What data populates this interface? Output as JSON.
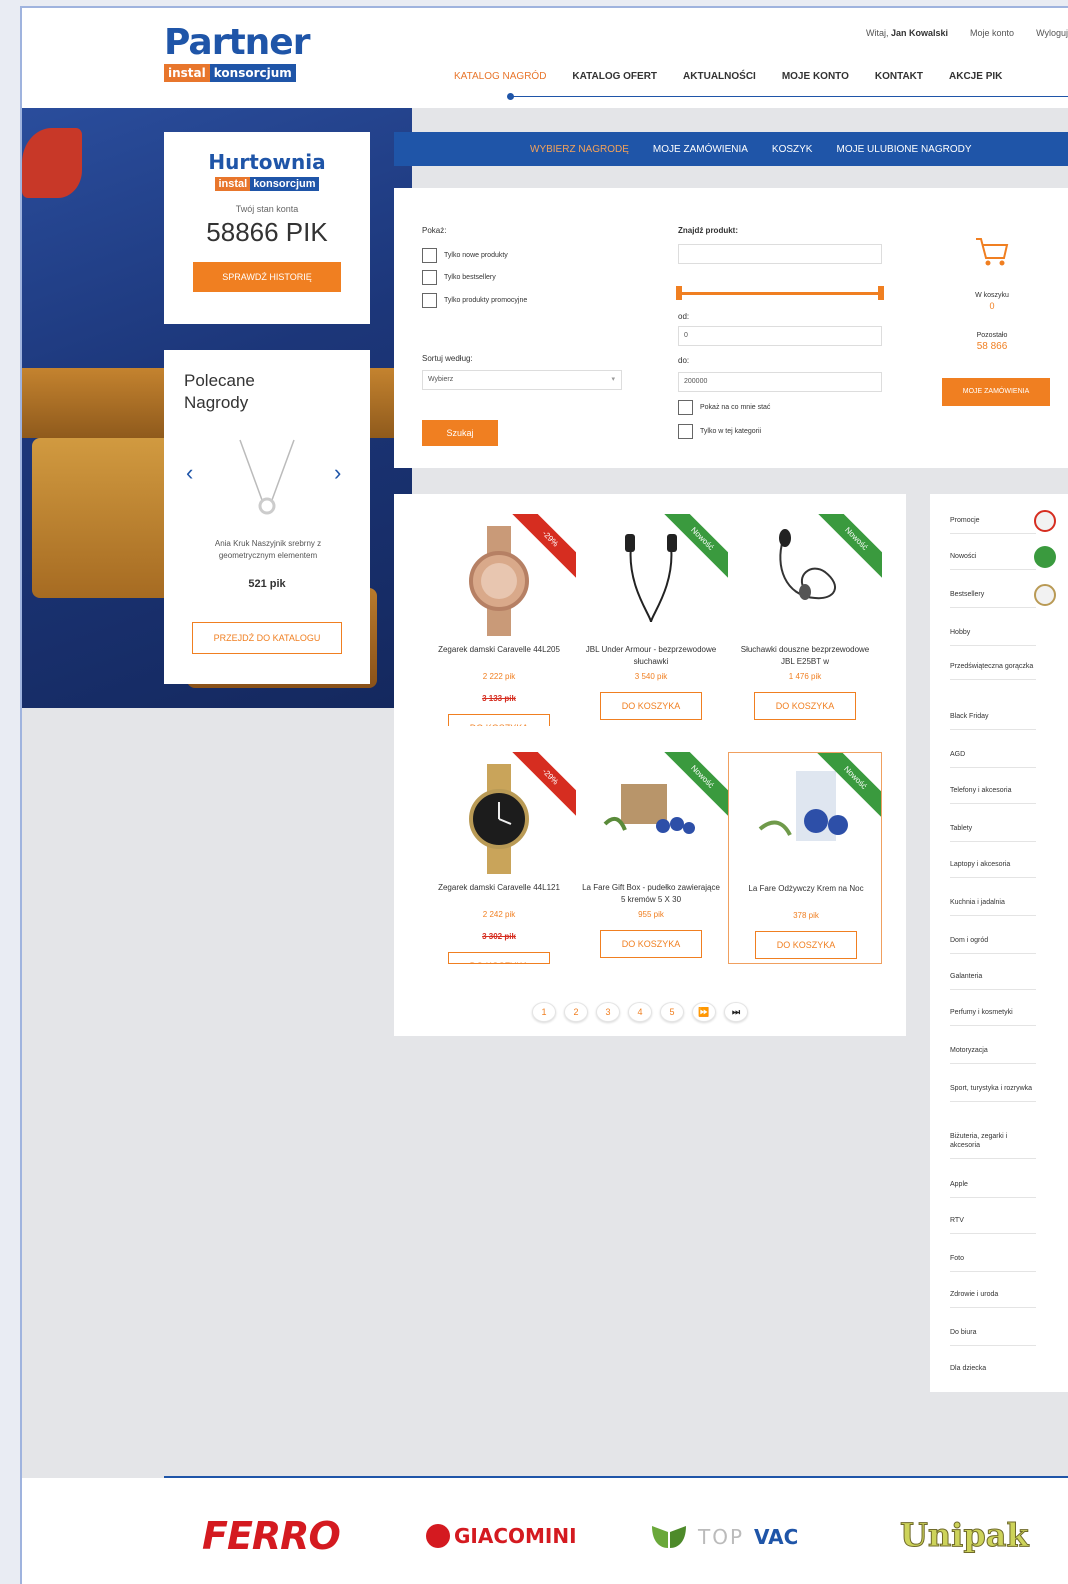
{
  "header": {
    "logo": {
      "word": "Partner",
      "sub_a": "instal",
      "sub_b": "konsorcjum"
    },
    "top_links": {
      "greeting": "Witaj,",
      "user": "Jan Kowalski",
      "account": "Moje konto",
      "logout": "Wyloguj"
    },
    "nav": [
      "KATALOG NAGRÓD",
      "KATALOG OFERT",
      "AKTUALNOŚCI",
      "MOJE KONTO",
      "KONTAKT",
      "AKCJE PIK"
    ]
  },
  "account": {
    "brand": "Hurtownia",
    "brand_sub_a": "instal",
    "brand_sub_b": "konsorcjum",
    "balance_label": "Twój stan konta",
    "balance": "58866 PIK",
    "history_button": "SPRAWDŹ HISTORIĘ"
  },
  "recommended": {
    "title_line1": "Polecane",
    "title_line2": "Nagrody",
    "item_name": "Ania Kruk Naszyjnik srebrny z geometrycznym elementem",
    "item_price": "521 pik",
    "catalog_button": "PRZEJDŹ DO KATALOGU"
  },
  "subnav": [
    "WYBIERZ NAGRODĘ",
    "MOJE ZAMÓWIENIA",
    "KOSZYK",
    "MOJE ULUBIONE NAGRODY"
  ],
  "filter": {
    "show_label": "Pokaż:",
    "checkboxes": [
      "Tylko nowe produkty",
      "Tylko bestsellery",
      "Tylko produkty promocyjne"
    ],
    "sort_label": "Sortuj według:",
    "sort_value": "Wybierz",
    "search_button": "Szukaj",
    "find_label": "Znajdź produkt:",
    "from_label": "od:",
    "from_value": "0",
    "to_label": "do:",
    "to_value": "200000",
    "afford_check": "Pokaż na co mnie stać",
    "category_check": "Tylko w tej kategorii",
    "cart_label": "W koszyku",
    "cart_count": "0",
    "remaining_label": "Pozostało",
    "remaining_value": "58 866",
    "orders_button": "MOJE ZAMÓWIENIA"
  },
  "products": [
    {
      "name": "Zegarek damski Caravelle 44L205",
      "price": "2 222 pik",
      "old_price": "3 133 pik",
      "badge": "-29%",
      "button": "DO KOSZYKA"
    },
    {
      "name": "JBL Under Armour - bezprzewodowe słuchawki",
      "price": "3 540 pik",
      "old_price": "",
      "badge": "Nowość",
      "button": "DO KOSZYKA"
    },
    {
      "name": "Słuchawki douszne bezprzewodowe JBL E25BT w",
      "price": "1 476 pik",
      "old_price": "",
      "badge": "Nowość",
      "button": "DO KOSZYKA"
    },
    {
      "name": "Zegarek damski Caravelle 44L121",
      "price": "2 242 pik",
      "old_price": "3 302 pik",
      "badge": "-29%",
      "button": "DO KOSZYKA"
    },
    {
      "name": "La Fare Gift Box - pudełko zawierające 5 kremów 5 X 30",
      "price": "955 pik",
      "old_price": "",
      "badge": "Nowość",
      "button": "DO KOSZYKA"
    },
    {
      "name": "La Fare Odżywczy Krem na Noc",
      "price": "378 pik",
      "old_price": "",
      "badge": "Nowość",
      "button": "DO KOSZYKA"
    }
  ],
  "pager": [
    "1",
    "2",
    "3",
    "4",
    "5",
    "⏩",
    "⏭"
  ],
  "categories": [
    "Promocje",
    "Nowości",
    "Bestsellery",
    "Hobby",
    "Przedświąteczna gorączka",
    "Black Friday",
    "AGD",
    "Telefony i akcesoria",
    "Tablety",
    "Laptopy i akcesoria",
    "Kuchnia i jadalnia",
    "Dom i ogród",
    "Galanteria",
    "Perfumy i kosmetyki",
    "Motoryzacja",
    "Sport, turystyka i rozrywka",
    "Biżuteria, zegarki i akcesoria",
    "Apple",
    "RTV",
    "Foto",
    "Zdrowie i uroda",
    "Do biura",
    "Dla dziecka"
  ],
  "footer": {
    "brands": [
      "FERRO",
      "GIACOMINI",
      "TOP",
      "VAC",
      "Unipak"
    ]
  },
  "colors": {
    "blue": "#1f55a8",
    "orange": "#f07f21",
    "red_badge": "#d62d20",
    "green_badge": "#3a9a3e"
  }
}
